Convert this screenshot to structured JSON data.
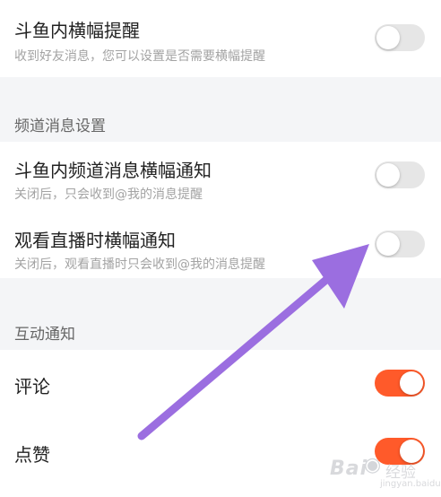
{
  "banner_section": {
    "title": "斗鱼内横幅提醒",
    "subtitle": "收到好友消息，您可以设置是否需要横幅提醒",
    "enabled": false
  },
  "channel_section": {
    "header": "频道消息设置",
    "items": [
      {
        "title": "斗鱼内频道消息横幅通知",
        "subtitle": "关闭后，只会收到@我的消息提醒",
        "enabled": false
      },
      {
        "title": "观看直播时横幅通知",
        "subtitle": "关闭后，观看直播时只会收到@我的消息提醒",
        "enabled": false
      }
    ]
  },
  "interaction_section": {
    "header": "互动通知",
    "items": [
      {
        "title": "评论",
        "enabled": true
      },
      {
        "title": "点赞",
        "enabled": true
      }
    ]
  },
  "colors": {
    "toggle_on": "#ff5a2a",
    "toggle_off": "#e6e6e6",
    "annotation_arrow": "#9b6ee0"
  },
  "watermark": {
    "brand": "Bai",
    "brand_suffix": "经验",
    "url": "jingyan.baidu.com"
  }
}
